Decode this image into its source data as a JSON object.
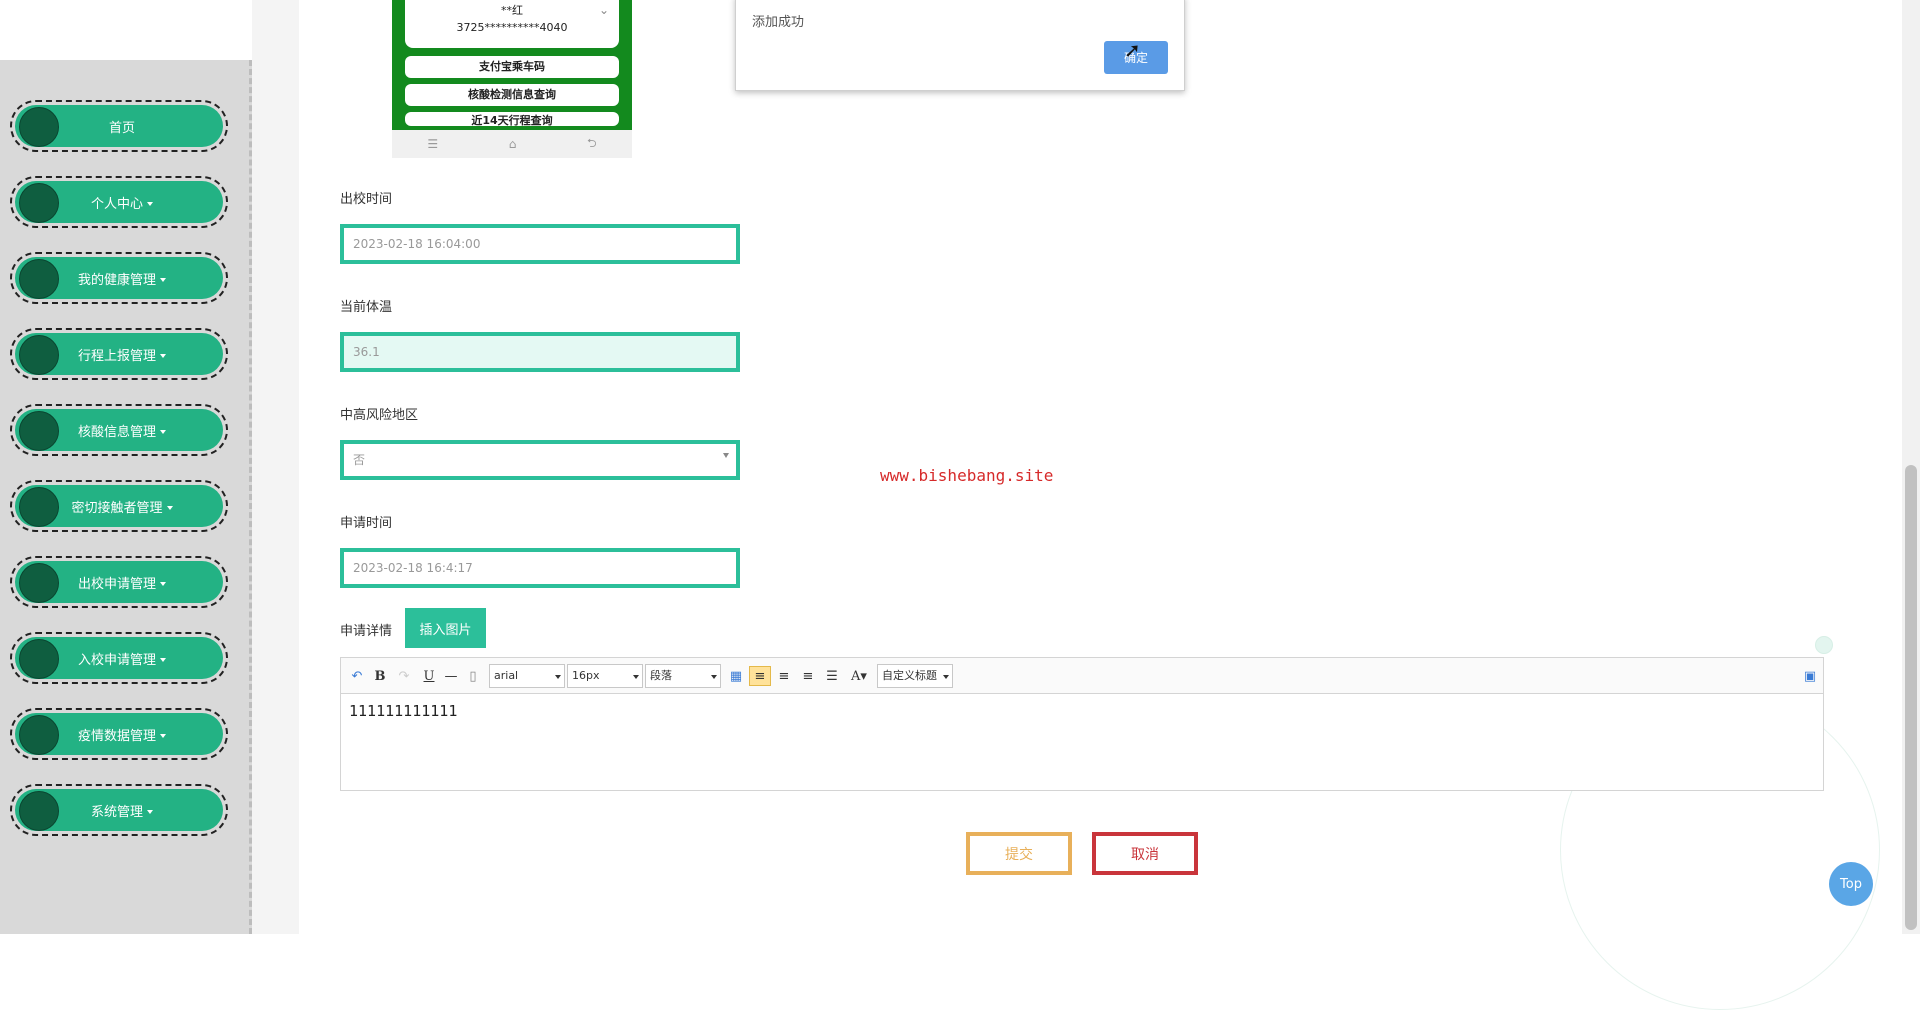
{
  "sidebar": {
    "items": [
      {
        "label": "首页",
        "caret": false
      },
      {
        "label": "个人中心",
        "caret": true
      },
      {
        "label": "我的健康管理",
        "caret": true
      },
      {
        "label": "行程上报管理",
        "caret": true
      },
      {
        "label": "核酸信息管理",
        "caret": true
      },
      {
        "label": "密切接触者管理",
        "caret": true
      },
      {
        "label": "出校申请管理",
        "caret": true
      },
      {
        "label": "入校申请管理",
        "caret": true
      },
      {
        "label": "疫情数据管理",
        "caret": true
      },
      {
        "label": "系统管理",
        "caret": true
      }
    ]
  },
  "phone_preview": {
    "name": "**红",
    "id_number": "3725**********4040",
    "buttons": [
      "支付宝乘车码",
      "核酸检测信息查询",
      "近14天行程查询"
    ],
    "nav_icons": [
      "☰",
      "⌂",
      "⮌"
    ]
  },
  "alert": {
    "message": "添加成功",
    "ok_label": "确定"
  },
  "form": {
    "leave_time": {
      "label": "出校时间",
      "value": "2023-02-18 16:04:00"
    },
    "temperature": {
      "label": "当前体温",
      "value": "36.1"
    },
    "risk_area": {
      "label": "中高风险地区",
      "value": "否"
    },
    "apply_time": {
      "label": "申请时间",
      "value": "2023-02-18 16:4:17"
    },
    "details": {
      "label": "申请详情",
      "insert_image_label": "插入图片"
    }
  },
  "editor": {
    "font_family": "arial",
    "font_size": "16px",
    "paragraph": "段落",
    "custom_title": "自定义标题",
    "content": "111111111111"
  },
  "actions": {
    "submit_label": "提交",
    "cancel_label": "取消"
  },
  "watermark": "www.bishebang.site",
  "top_label": "Top",
  "colors": {
    "accent": "#2cbf9a",
    "nav_green": "#23b284",
    "submit": "#e8b05a",
    "cancel": "#c9353b",
    "dialog_button": "#5a9be6"
  }
}
